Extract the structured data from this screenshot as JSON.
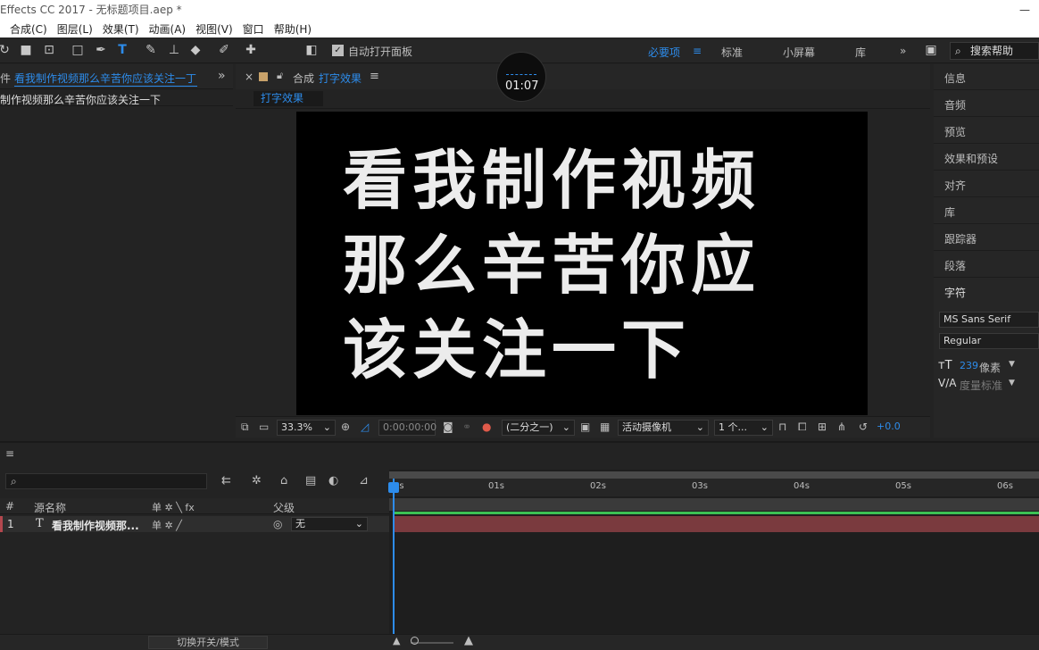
{
  "window": {
    "title": "Effects CC 2017 - 无标题项目.aep *",
    "minimize": "—"
  },
  "menu": [
    "合成(C)",
    "图层(L)",
    "效果(T)",
    "动画(A)",
    "视图(V)",
    "窗口",
    "帮助(H)"
  ],
  "toolbar": {
    "auto_open_label": "自动打开面板",
    "workspaces": [
      "必要项",
      "标准",
      "小屏幕",
      "库"
    ],
    "active_workspace": "必要项",
    "menu_glyph": "≡",
    "more_glyph": "»",
    "search_placeholder": "搜索帮助"
  },
  "timer_overlay": "01:07",
  "left_panel": {
    "tab_prefix": "件",
    "tab_title": "看我制作视频那么辛苦你应该关注一丁",
    "more_glyph": "»",
    "preview_text": "制作视频那么辛苦你应该关注一下"
  },
  "comp_panel": {
    "close_glyph": "×",
    "title_prefix": "合成",
    "comp_name": "打字效果",
    "menu_glyph": "≡",
    "chip": "打字效果",
    "viewer_lines": [
      "看我制作视频",
      "那么辛苦你应",
      "该关注一下"
    ]
  },
  "comp_footer": {
    "zoom": "33.3%",
    "timecode": "0:00:00:00",
    "resolution": "(二分之一)",
    "camera": "活动摄像机",
    "views": "1 个...",
    "exposure": "+0.0"
  },
  "right_panel": {
    "items": [
      "信息",
      "音频",
      "预览",
      "效果和预设",
      "对齐",
      "库",
      "跟踪器",
      "段落",
      "字符"
    ],
    "font": "MS Sans Serif",
    "style": "Regular",
    "size_value": "239",
    "size_unit": "像素",
    "tracking": "度量标准"
  },
  "timeline": {
    "menu_glyph": "≡",
    "columns": {
      "num": "#",
      "source": "源名称",
      "switches": "单 ✲ ╲ fx",
      "parent": "父级"
    },
    "ruler_ticks": [
      "0s",
      "01s",
      "02s",
      "03s",
      "04s",
      "05s",
      "06s"
    ],
    "layers": [
      {
        "num": "1",
        "type_icon": "T",
        "name": "看我制作视频那...",
        "parent": "无"
      }
    ],
    "toggle_label": "切换开关/模式"
  },
  "colors": {
    "accent": "#2d8ceb",
    "layer_bar": "#7a3a3e",
    "green": "#3cc254"
  }
}
